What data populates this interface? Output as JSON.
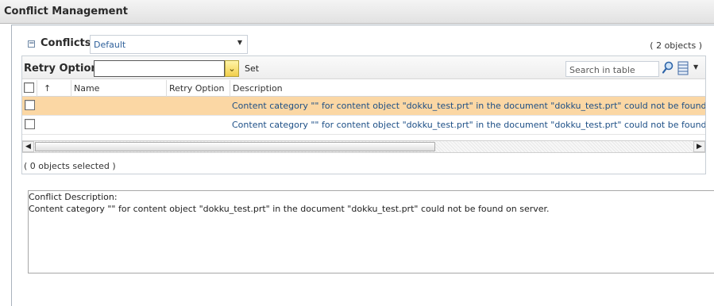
{
  "window": {
    "title": "Conflict Management"
  },
  "conflicts": {
    "label": "Conflicts",
    "collapse_glyph": "−",
    "view_selected": "Default",
    "object_count": "( 2 objects )"
  },
  "toolbar": {
    "retry_label": "Retry Option",
    "retry_value": "",
    "set_label": "Set",
    "search_placeholder": "Search in table"
  },
  "table": {
    "columns": {
      "sort": "↑",
      "name": "Name",
      "retry_option": "Retry Option",
      "description": "Description"
    },
    "rows": [
      {
        "name": "",
        "retry_option": "",
        "description": "Content category \"\" for content object \"dokku_test.prt\" in the document \"dokku_test.prt\" could not be found on server.",
        "selected": true
      },
      {
        "name": "",
        "retry_option": "",
        "description": "Content category \"\" for content object \"dokku_test.prt\" in the document \"dokku_test.prt\" could not be found on server.",
        "selected": false
      }
    ],
    "selected_count": "( 0 objects selected )"
  },
  "detail": {
    "label": "Conflict Description:",
    "text": "Content category \"\" for content object \"dokku_test.prt\" in the document \"dokku_test.prt\" could not be found on server."
  },
  "colors": {
    "selected_row": "#fbd7a4",
    "link_text": "#1d4f86"
  }
}
